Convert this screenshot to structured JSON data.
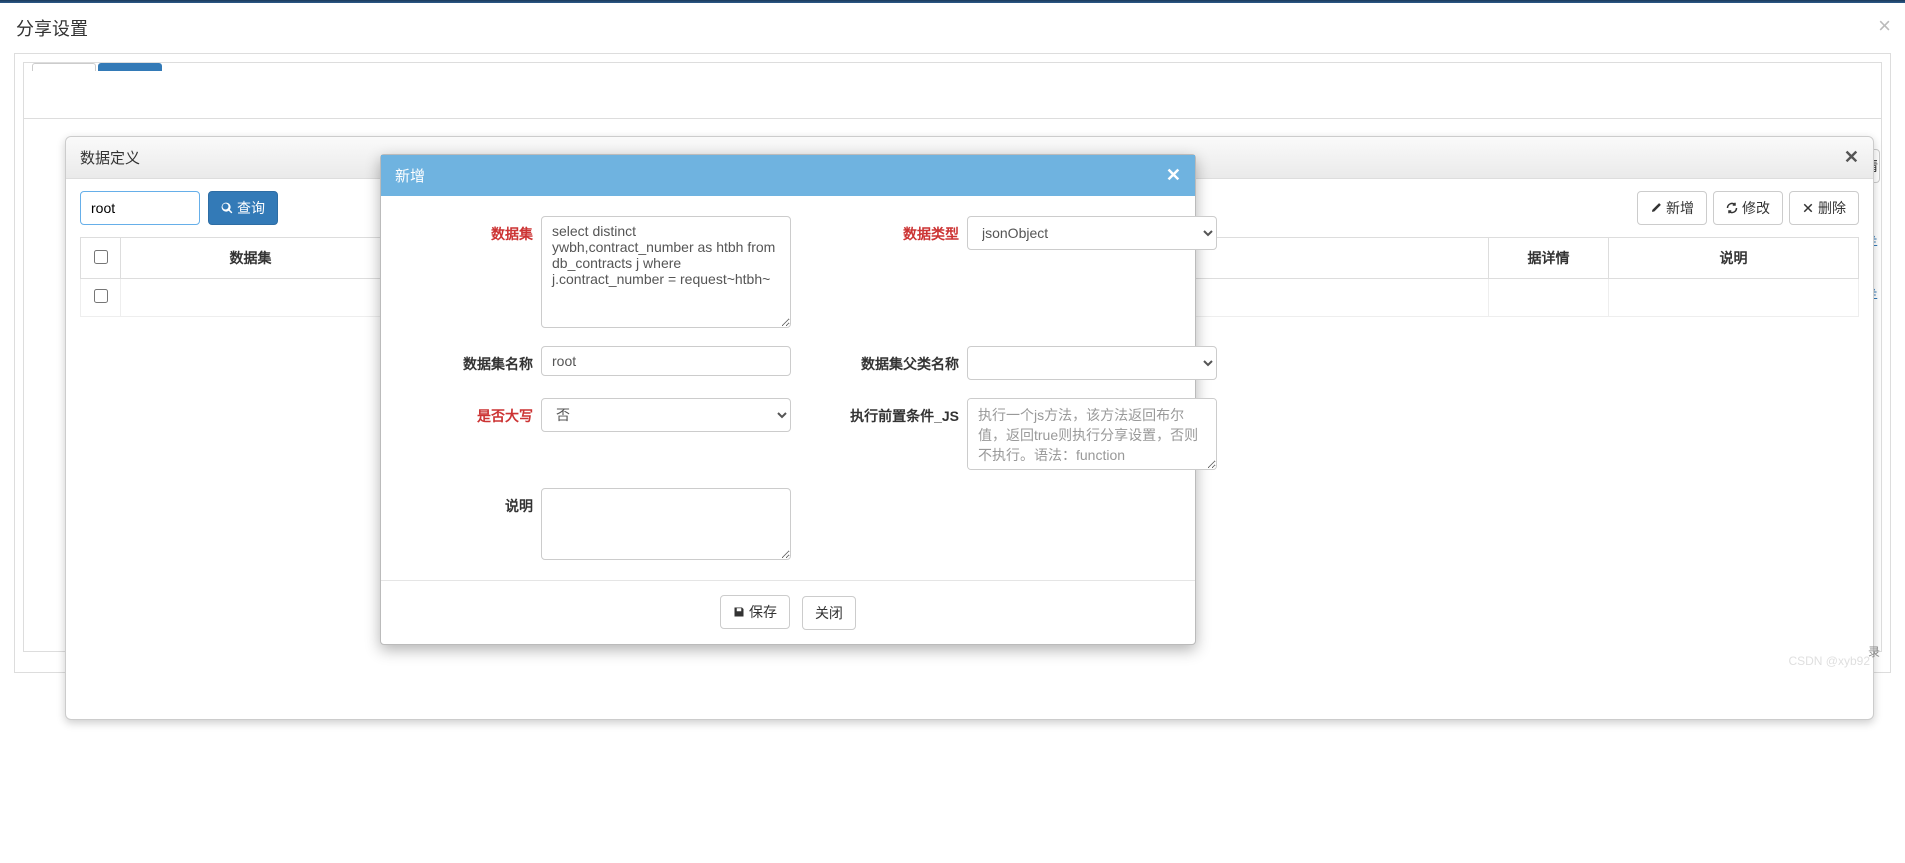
{
  "header": {
    "title": "分享设置",
    "close_icon": "×"
  },
  "inner": {
    "title": "数据定义",
    "close_icon": "✕",
    "search_value": "root",
    "query_btn": "查询",
    "add_btn": "新增",
    "edit_btn": "修改",
    "delete_btn": "删除",
    "columns": {
      "c1": "数据集",
      "c2": "据详情",
      "c3": "说明"
    },
    "partial_edge_1": "羊",
    "partial_edge_2": "羊",
    "partial_btn_frag": "情",
    "partial_btn_rec": "录"
  },
  "modal": {
    "title": "新增",
    "close_icon": "✕",
    "labels": {
      "dataset": "数据集",
      "datatype": "数据类型",
      "dsname": "数据集名称",
      "parent": "数据集父类名称",
      "upper": "是否大写",
      "prejs": "执行前置条件_JS",
      "desc": "说明"
    },
    "values": {
      "dataset_sql": "select distinct ywbh,contract_number as htbh from db_contracts j where j.contract_number = request~htbh~",
      "datatype": "jsonObject",
      "dsname": "root",
      "parent": "",
      "upper": "否",
      "prejs_placeholder": "执行一个js方法，该方法返回布尔值，返回true则执行分享设置，否则不执行。语法：function",
      "desc": ""
    },
    "buttons": {
      "save": "保存",
      "close": "关闭"
    }
  },
  "watermark": "CSDN @xyb92"
}
